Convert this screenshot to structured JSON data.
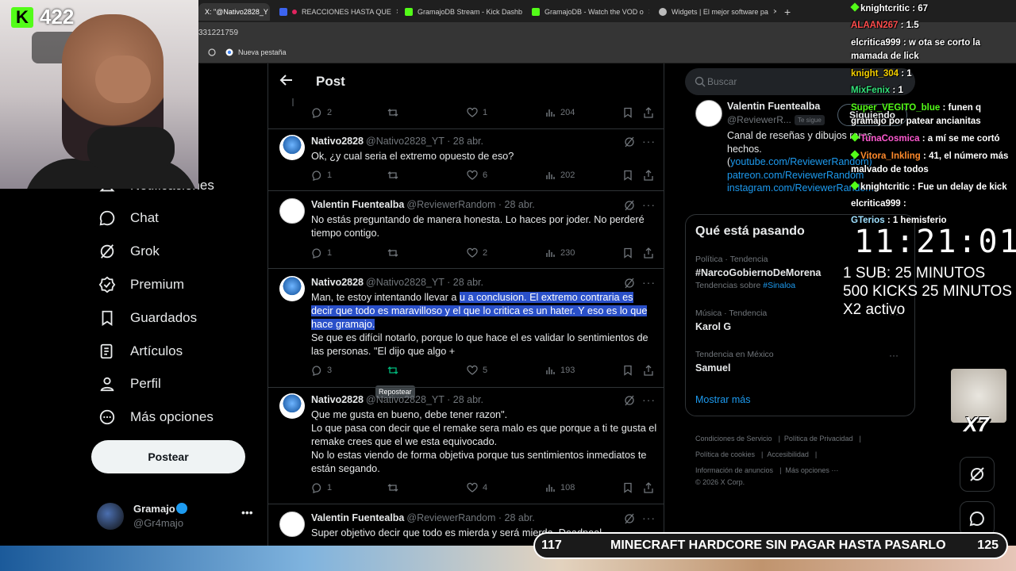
{
  "browser": {
    "tabs": [
      {
        "title": "X: \"@Nativo2828_Y",
        "color": "#888"
      },
      {
        "title": "REACCIONES HASTA QUE",
        "color": "#e0245e"
      },
      {
        "title": "GramajoDB Stream - Kick Dashb",
        "color": "#53fc18"
      },
      {
        "title": "GramajoDB - Watch the VOD o",
        "color": "#53fc18"
      },
      {
        "title": "Widgets | El mejor software pa",
        "color": "#bbb"
      }
    ],
    "new_tab": "+",
    "address_fragment": "331221759",
    "bookmark": "Nueva pestaña"
  },
  "nav": {
    "notifications": "Notificaciones",
    "chat": "Chat",
    "grok": "Grok",
    "premium": "Premium",
    "saved": "Guardados",
    "articles": "Artículos",
    "profile": "Perfil",
    "more": "Más opciones",
    "post_button": "Postear"
  },
  "account": {
    "name": "Gramajo",
    "handle": "@Gr4majo",
    "more": "•••"
  },
  "header": {
    "title": "Post"
  },
  "tweets": [
    {
      "name": "Nativo2828",
      "handle": "@Nativo2828_YT · 28 abr.",
      "text": "Ok, ¿y cual seria el extremo opuesto de eso?",
      "replies": "1",
      "likes": "6",
      "views": "202"
    },
    {
      "name": "Valentin Fuentealba",
      "handle": "@ReviewerRandom · 28 abr.",
      "text": "No estás preguntando de manera honesta. Lo haces por joder. No perderé tiempo contigo.",
      "replies": "1",
      "likes": "2",
      "views": "230"
    },
    {
      "name": "Nativo2828",
      "handle": "@Nativo2828_YT · 28 abr.",
      "text_before": "Man, te estoy intentando llevar a ",
      "text_highlight": "u a conclusion. El extremo contraria es decir que todo es maravilloso y el que lo critica es un hater. Y eso es lo que hace gramajo.",
      "text_after": "Se que es difícil notarlo, porque lo que hace el es validar lo sentimientos de las personas. \"El dijo que algo +",
      "replies": "3",
      "likes": "5",
      "views": "193"
    },
    {
      "name": "Nativo2828",
      "handle": "@Nativo2828_YT · 28 abr.",
      "text": "Que me gusta en bueno, debe tener razon\".\nLo que pasa con decir que el remake sera malo es que porque a ti te gusta el remake crees que el we esta equivocado.\nNo lo estas viendo de forma objetiva porque tus sentimientos inmediatos te están segando.",
      "replies": "1",
      "likes": "4",
      "views": "108"
    },
    {
      "name": "Valentin Fuentealba",
      "handle": "@ReviewerRandom · 28 abr.",
      "text": "Super objetivo decir que todo es mierda y será mierda. Deadpool...",
      "replies": "",
      "likes": "",
      "views": ""
    }
  ],
  "top_actions": {
    "replies": "2",
    "likes": "1",
    "views": "204"
  },
  "tooltip": "Repostear",
  "search": {
    "placeholder": "Buscar"
  },
  "profile_card": {
    "name": "Valentin Fuentealba",
    "handle": "@ReviewerR...",
    "follows_you": "Te sigue",
    "button": "Siguiendo",
    "bio": "Canal de reseñas y dibujos raros hechos.",
    "link1": "youtube.com/ReviewerRandom)",
    "link2": "patreon.com/ReviewerRandom",
    "link3": "instagram.com/ReviewerRandom"
  },
  "trends": {
    "title": "Qué está pasando",
    "items": [
      {
        "category": "Política · Tendencia",
        "name": "#NarcoGobiernoDeMorena",
        "sub_label": "Tendencias sobre",
        "sub_link": "#Sinaloa"
      },
      {
        "category": "Música · Tendencia",
        "name": "Karol G"
      },
      {
        "category": "Tendencia en México",
        "name": "Samuel"
      }
    ],
    "show_more": "Mostrar más"
  },
  "footer": {
    "links": [
      "Condiciones de Servicio",
      "Política de Privacidad",
      "Política de cookies",
      "Accesibilidad",
      "Información de anuncios",
      "Más opciones ···"
    ],
    "copyright": "© 2026 X Corp."
  },
  "stream": {
    "kick_count": "422",
    "chat": [
      {
        "user": "knightcritic",
        "msg": ": 67",
        "color": "#ffffff"
      },
      {
        "user": "ALAAN267",
        "msg": ": 1.5",
        "color": "#ff4d4d"
      },
      {
        "user": "elcritica999",
        "msg": ": w ota se corto la mamada de lick",
        "color": "#ffffff"
      },
      {
        "user": "knight_304",
        "msg": ": 1",
        "color": "#f5d000"
      },
      {
        "user": "MixFenix",
        "msg": ": 1",
        "color": "#33e07a"
      },
      {
        "user": "Super_VEGITO_blue",
        "msg": ": funen q gramajo por patear ancianitas",
        "color": "#53fc18"
      },
      {
        "user": "TunaCosmica",
        "msg": ": a mí se me cortó",
        "color": "#ff5ad1"
      },
      {
        "user": "Vitora_Inkling",
        "msg": ": 41, el número más malvado de todos",
        "color": "#ff8a2b"
      },
      {
        "user": "knightcritic",
        "msg": ": Fue un delay de kick",
        "color": "#ffffff"
      },
      {
        "user": "elcritica999",
        "msg": ":",
        "color": "#ffffff"
      },
      {
        "user": "GTerios",
        "msg": ": 1 hemisferio",
        "color": "#9fe0ff"
      }
    ],
    "clock": "11:21:01",
    "goal1": "1 SUB: 25 MINUTOS",
    "goal2": "500 KICKS 25 MINUTOS",
    "goal3": "X2 activo",
    "cat_label": "X7",
    "ticker_left": "117",
    "ticker_text": "MINECRAFT HARDCORE SIN PAGAR HASTA PASARLO",
    "ticker_right": "125"
  }
}
